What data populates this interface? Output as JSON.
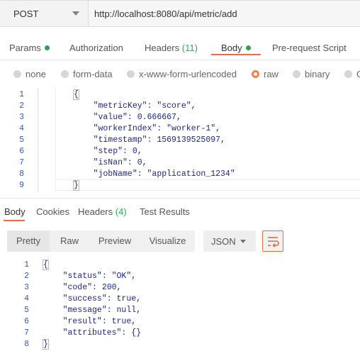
{
  "request": {
    "method": "POST",
    "url": "http://localhost:8080/api/metric/add"
  },
  "request_tabs": [
    {
      "label": "Params",
      "count": "",
      "dot": true
    },
    {
      "label": "Authorization",
      "count": "",
      "dot": false
    },
    {
      "label": "Headers ",
      "count": "(11)",
      "dot": false
    },
    {
      "label": "Body",
      "count": "",
      "dot": true,
      "active": true
    },
    {
      "label": "Pre-request Script",
      "count": "",
      "dot": false
    }
  ],
  "body_types": [
    {
      "label": "none",
      "selected": false
    },
    {
      "label": "form-data",
      "selected": false
    },
    {
      "label": "x-www-form-urlencoded",
      "selected": false
    },
    {
      "label": "raw",
      "selected": true
    },
    {
      "label": "binary",
      "selected": false
    },
    {
      "label": "G",
      "selected": false
    }
  ],
  "request_body": {
    "line_numbers": [
      "1",
      "2",
      "3",
      "4",
      "5",
      "6",
      "7",
      "8",
      "9"
    ],
    "lines": [
      "{",
      "    \"metricKey\": \"score\",",
      "    \"value\": 0.666667,",
      "    \"workerIndex\": \"worker-1\",",
      "    \"timestamp\": 1569139525097,",
      "    \"step\": 0,",
      "    \"isNan\": 0,",
      "    \"jobName\": \"application_1234\"",
      "}"
    ]
  },
  "response_tabs": [
    {
      "label": "Body",
      "count": "",
      "active": true
    },
    {
      "label": "Cookies",
      "count": ""
    },
    {
      "label": "Headers ",
      "count": "(4)"
    },
    {
      "label": "Test Results",
      "count": ""
    }
  ],
  "response_toolbar": {
    "views": [
      "Pretty",
      "Raw",
      "Preview",
      "Visualize"
    ],
    "active_view": "Pretty",
    "format": "JSON",
    "wrap_icon": "wrap-lines-icon"
  },
  "response_body": {
    "line_numbers": [
      "1",
      "2",
      "3",
      "4",
      "5",
      "6",
      "7",
      "8"
    ],
    "lines": [
      "{",
      "    \"status\": \"OK\",",
      "    \"code\": 200,",
      "    \"success\": true,",
      "    \"message\": null,",
      "    \"result\": true,",
      "    \"attributes\": {}",
      "}"
    ]
  },
  "colors": {
    "accent": "#f26b3a",
    "status_green": "#2fa14d",
    "code_text": "#1e2a78",
    "line_number": "#3b5ab8"
  }
}
